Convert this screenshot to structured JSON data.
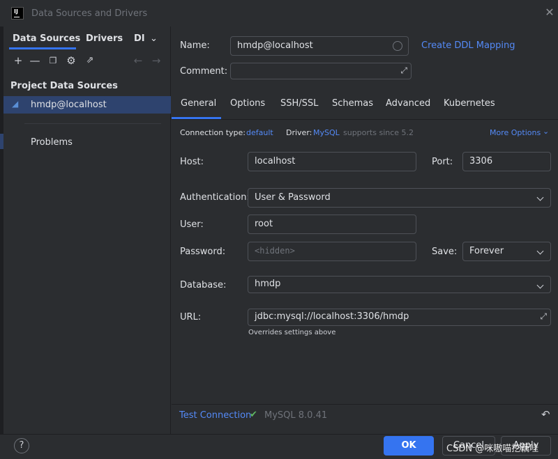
{
  "window": {
    "title": "Data Sources and Drivers",
    "app_icon": "IJ"
  },
  "left": {
    "tabs": [
      "Data Sources",
      "Drivers",
      "DI"
    ],
    "section_title": "Project Data Sources",
    "datasource": "hmdp@localhost",
    "problems": "Problems"
  },
  "form": {
    "name_label": "Name:",
    "name_value": "hmdp@localhost",
    "create_ddl": "Create DDL Mapping",
    "comment_label": "Comment:",
    "comment_value": "",
    "tabs": [
      "General",
      "Options",
      "SSH/SSL",
      "Schemas",
      "Advanced",
      "Kubernetes"
    ],
    "conn_type_label": "Connection type:",
    "conn_type_value": "default",
    "driver_label": "Driver:",
    "driver_value": "MySQL",
    "driver_note": "supports since 5.2",
    "more_options": "More Options",
    "host_label": "Host:",
    "host_value": "localhost",
    "port_label": "Port:",
    "port_value": "3306",
    "auth_label": "Authentication:",
    "auth_value": "User & Password",
    "user_label": "User:",
    "user_value": "root",
    "password_label": "Password:",
    "password_placeholder": "<hidden>",
    "save_label": "Save:",
    "save_value": "Forever",
    "database_label": "Database:",
    "database_value": "hmdp",
    "url_label": "URL:",
    "url_value": "jdbc:mysql://localhost:3306/hmdp",
    "url_note": "Overrides settings above"
  },
  "test": {
    "label": "Test Connection",
    "result": "MySQL 8.0.41"
  },
  "footer": {
    "help": "?",
    "ok": "OK",
    "cancel": "Cancel",
    "apply": "Apply",
    "watermark": "CSDN @咪嗷喵挖藕哇"
  },
  "colors": {
    "accent": "#3574f0",
    "link": "#548af7",
    "selection": "#2e436e",
    "success": "#5fb865"
  }
}
